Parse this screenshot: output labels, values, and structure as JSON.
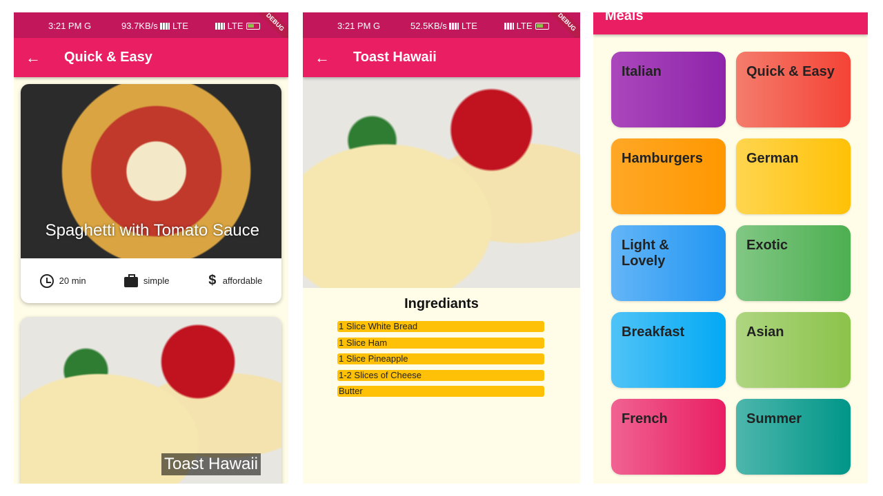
{
  "status_bars": [
    {
      "time": "3:21 PM G",
      "speed": "93.7KB/s",
      "network": "LTE",
      "network2": "LTE",
      "debug": "DEBUG"
    },
    {
      "time": "3:21 PM G",
      "speed": "52.5KB/s",
      "network": "LTE",
      "network2": "LTE",
      "debug": "DEBUG"
    }
  ],
  "panel1": {
    "title": "Quick & Easy",
    "back_icon": "arrow-back-icon",
    "meals": [
      {
        "title": "Spaghetti with Tomato Sauce",
        "duration": "20 min",
        "complexity": "simple",
        "affordability": "affordable"
      },
      {
        "title": "Toast Hawaii"
      }
    ]
  },
  "panel2": {
    "title": "Toast Hawaii",
    "back_icon": "arrow-back-icon",
    "section_title": "Ingrediants",
    "ingredients": [
      "1 Slice White Bread",
      "1 Slice Ham",
      "1 Slice Pineapple",
      "1-2 Slices of Cheese",
      "Butter"
    ]
  },
  "panel3": {
    "header": "Meals",
    "categories": [
      {
        "label": "Italian",
        "from": "#ab47bc",
        "to": "#8e24aa"
      },
      {
        "label": "Quick & Easy",
        "from": "#f47c6c",
        "to": "#f44336"
      },
      {
        "label": "Hamburgers",
        "from": "#ffa726",
        "to": "#ff9800"
      },
      {
        "label": "German",
        "from": "#ffd54f",
        "to": "#ffc107"
      },
      {
        "label": "Light & Lovely",
        "from": "#64b5f6",
        "to": "#2196f3"
      },
      {
        "label": "Exotic",
        "from": "#81c784",
        "to": "#4caf50"
      },
      {
        "label": "Breakfast",
        "from": "#4fc3f7",
        "to": "#03a9f4"
      },
      {
        "label": "Asian",
        "from": "#aed581",
        "to": "#8bc34a"
      },
      {
        "label": "French",
        "from": "#f06292",
        "to": "#e91e63"
      },
      {
        "label": "Summer",
        "from": "#4db6ac",
        "to": "#009688"
      }
    ]
  }
}
